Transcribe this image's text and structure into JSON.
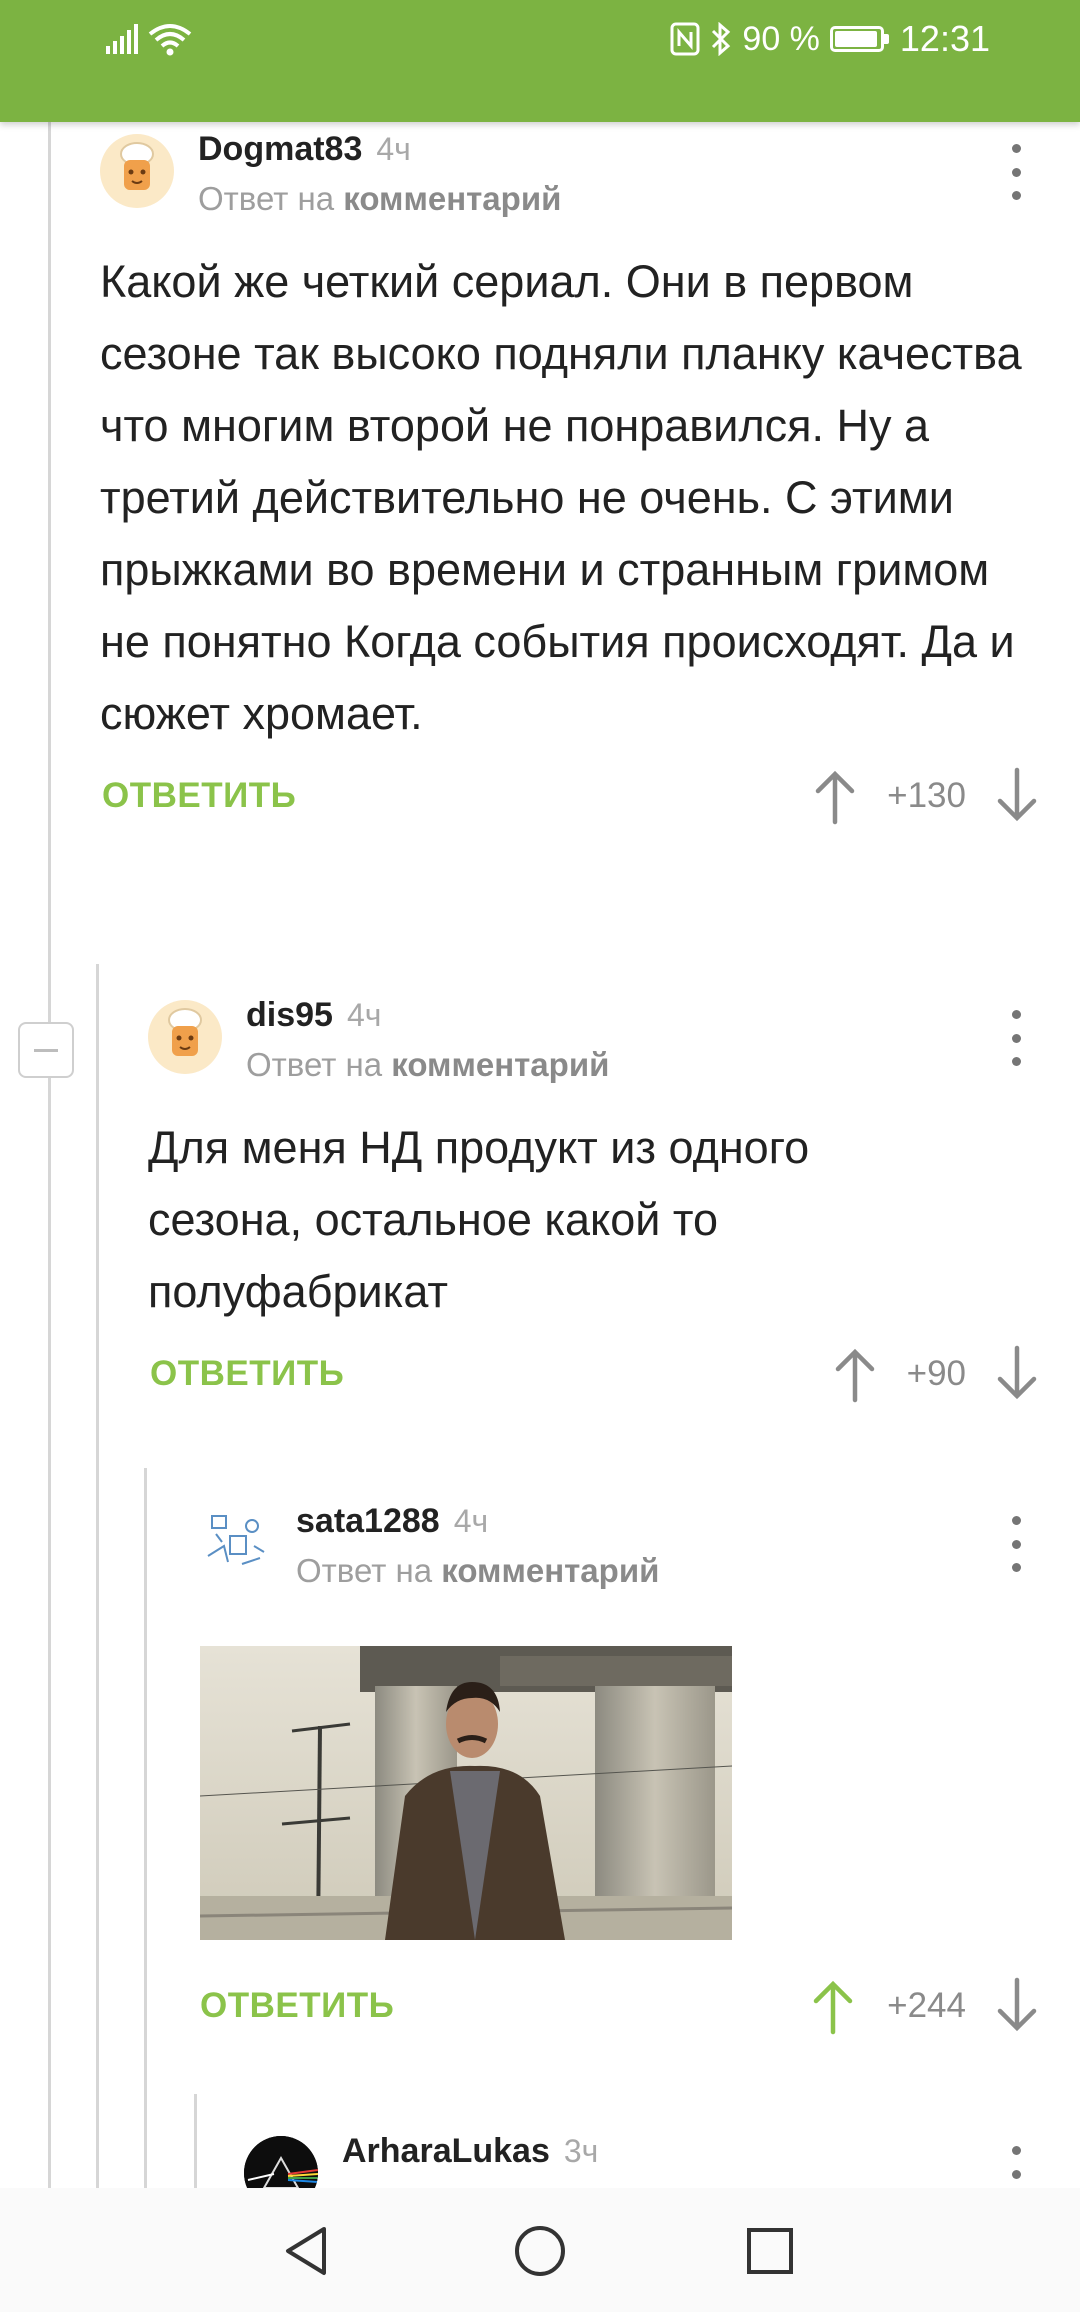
{
  "status_bar": {
    "battery": "90 %",
    "time": "12:31"
  },
  "comments": [
    {
      "user": "Dogmat83",
      "time": "4ч",
      "reply_prefix": "Ответ на",
      "reply_link": "комментарий",
      "text": "Какой же четкий сериал. Они в первом сезоне так высоко подняли планку качества что многим второй не понравился. Ну а третий действительно не очень. С этими прыжками во времени и странным гримом не понятно Когда события происходят. Да и сюжет хромает.",
      "reply_label": "ОТВЕТИТЬ",
      "score": "+130"
    },
    {
      "user": "dis95",
      "time": "4ч",
      "reply_prefix": "Ответ на",
      "reply_link": "комментарий",
      "text": "Для меня НД продукт из одного сезона, остальное какой то полуфабрикат",
      "reply_label": "ОТВЕТИТЬ",
      "score": "+90"
    },
    {
      "user": "sata1288",
      "time": "4ч",
      "reply_prefix": "Ответ на",
      "reply_link": "комментарий",
      "reply_label": "ОТВЕТИТЬ",
      "score": "+244"
    },
    {
      "user": "ArharaLukas",
      "time": "3ч"
    }
  ],
  "colors": {
    "accent": "#7cb342",
    "reply": "#8bc34a",
    "upvoted": "#8bc34a"
  },
  "icons": [
    "signal-icon",
    "wifi-icon",
    "nfc-icon",
    "bluetooth-icon",
    "battery-icon",
    "more-icon",
    "arrow-up-icon",
    "arrow-down-icon",
    "back-icon",
    "home-icon",
    "recents-icon"
  ]
}
